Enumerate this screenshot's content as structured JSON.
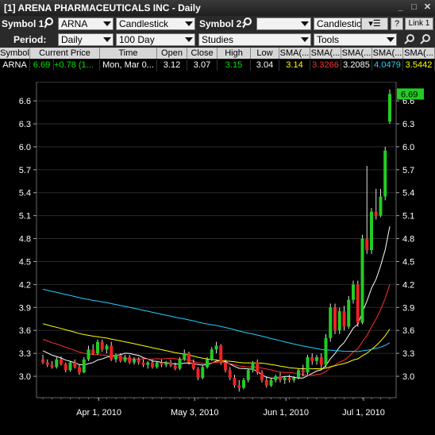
{
  "window": {
    "title": "[1] ARENA PHARMACEUTICALS INC - Daily"
  },
  "toolbar1": {
    "symbol1_label": "Symbol 1:",
    "symbol1_value": "ARNA",
    "chart_type": "Candlestick",
    "symbol2_label": "Symbol 2:",
    "symbol2_value": "",
    "chart_type2": "Candlestick",
    "help_label": "?",
    "link_label": "Link 1"
  },
  "toolbar2": {
    "period_label": "Period:",
    "period_value": "Daily",
    "range_value": "100 Day",
    "studies_value": "Studies",
    "tools_value": "Tools"
  },
  "quote": {
    "headers": [
      "Symbol",
      "Current Price",
      "Time",
      "Open",
      "Close",
      "High",
      "Low",
      "SMA(...",
      "SMA(...",
      "SMA(...",
      "SMA(...",
      "SMA(..."
    ],
    "values": [
      "ARNA",
      "6.69",
      "+0.78 (1...",
      "Mon, Mar 0...",
      "3.12",
      "3.07",
      "3.15",
      "3.04",
      "3.14",
      "3.3266",
      "3.2085",
      "4.0479",
      "3.5442"
    ],
    "colors": {
      "price": "#00e000",
      "high": "#00e000",
      "sma1": "#ffff00",
      "sma2": "#ff3030",
      "sma3": "#ffffff",
      "sma4": "#20d0ff",
      "sma5": "#ffff00"
    }
  },
  "chart_data": {
    "type": "candlestick",
    "y_ticks": [
      "6.6",
      "6.3",
      "6.0",
      "5.7",
      "5.4",
      "5.1",
      "4.8",
      "4.5",
      "4.2",
      "3.9",
      "3.6",
      "3.3",
      "3.0"
    ],
    "x_ticks": [
      "Apr 1, 2010",
      "May 3, 2010",
      "Jun 1, 2010",
      "Jul 1, 2010"
    ],
    "last_price_label": "6.69",
    "ylim": [
      2.72,
      6.85
    ],
    "candles": [
      [
        3.22,
        3.28,
        3.16,
        3.18
      ],
      [
        3.18,
        3.22,
        3.12,
        3.15
      ],
      [
        3.15,
        3.2,
        3.1,
        3.12
      ],
      [
        3.12,
        3.25,
        3.1,
        3.22
      ],
      [
        3.22,
        3.26,
        3.14,
        3.16
      ],
      [
        3.16,
        3.18,
        3.05,
        3.08
      ],
      [
        3.08,
        3.2,
        3.06,
        3.18
      ],
      [
        3.18,
        3.22,
        3.1,
        3.12
      ],
      [
        3.12,
        3.15,
        3.02,
        3.05
      ],
      [
        3.05,
        3.25,
        3.04,
        3.22
      ],
      [
        3.22,
        3.4,
        3.2,
        3.35
      ],
      [
        3.35,
        3.42,
        3.28,
        3.3
      ],
      [
        3.3,
        3.48,
        3.28,
        3.45
      ],
      [
        3.45,
        3.48,
        3.32,
        3.35
      ],
      [
        3.35,
        3.42,
        3.3,
        3.4
      ],
      [
        3.4,
        3.45,
        3.2,
        3.22
      ],
      [
        3.22,
        3.3,
        3.18,
        3.28
      ],
      [
        3.28,
        3.3,
        3.18,
        3.2
      ],
      [
        3.2,
        3.28,
        3.18,
        3.25
      ],
      [
        3.25,
        3.28,
        3.16,
        3.18
      ],
      [
        3.18,
        3.25,
        3.15,
        3.22
      ],
      [
        3.22,
        3.25,
        3.15,
        3.18
      ],
      [
        3.18,
        3.22,
        3.12,
        3.15
      ],
      [
        3.15,
        3.2,
        3.1,
        3.18
      ],
      [
        3.18,
        3.22,
        3.1,
        3.12
      ],
      [
        3.12,
        3.2,
        3.1,
        3.18
      ],
      [
        3.18,
        3.22,
        3.12,
        3.15
      ],
      [
        3.15,
        3.2,
        3.12,
        3.18
      ],
      [
        3.18,
        3.22,
        3.12,
        3.14
      ],
      [
        3.14,
        3.18,
        3.08,
        3.1
      ],
      [
        3.1,
        3.25,
        3.08,
        3.22
      ],
      [
        3.22,
        3.35,
        3.2,
        3.3
      ],
      [
        3.3,
        3.32,
        3.15,
        3.18
      ],
      [
        3.18,
        3.22,
        3.08,
        3.1
      ],
      [
        3.1,
        3.12,
        2.95,
        2.98
      ],
      [
        2.98,
        3.15,
        2.96,
        3.12
      ],
      [
        3.12,
        3.25,
        3.1,
        3.22
      ],
      [
        3.22,
        3.38,
        3.2,
        3.35
      ],
      [
        3.35,
        3.45,
        3.3,
        3.4
      ],
      [
        3.4,
        3.42,
        3.15,
        3.18
      ],
      [
        3.18,
        3.22,
        3.05,
        3.08
      ],
      [
        3.08,
        3.12,
        2.95,
        2.98
      ],
      [
        2.98,
        3.02,
        2.85,
        2.88
      ],
      [
        2.88,
        2.95,
        2.8,
        2.85
      ],
      [
        2.85,
        2.98,
        2.83,
        2.95
      ],
      [
        2.95,
        3.1,
        2.92,
        3.08
      ],
      [
        3.08,
        3.2,
        3.05,
        3.18
      ],
      [
        3.18,
        3.22,
        3.02,
        3.05
      ],
      [
        3.05,
        3.08,
        2.92,
        2.95
      ],
      [
        2.95,
        3.0,
        2.85,
        2.88
      ],
      [
        2.88,
        2.98,
        2.86,
        2.95
      ],
      [
        2.95,
        3.02,
        2.92,
        3.0
      ],
      [
        3.0,
        3.05,
        2.92,
        2.95
      ],
      [
        2.95,
        3.0,
        2.9,
        2.98
      ],
      [
        2.98,
        3.02,
        2.92,
        2.95
      ],
      [
        2.95,
        3.0,
        2.92,
        2.98
      ],
      [
        2.98,
        3.1,
        2.96,
        3.08
      ],
      [
        3.08,
        3.15,
        3.0,
        3.05
      ],
      [
        3.05,
        3.28,
        3.02,
        3.25
      ],
      [
        3.25,
        3.3,
        3.15,
        3.2
      ],
      [
        3.2,
        3.28,
        3.15,
        3.25
      ],
      [
        3.25,
        3.3,
        3.1,
        3.15
      ],
      [
        3.15,
        3.55,
        3.12,
        3.5
      ],
      [
        3.5,
        3.95,
        3.45,
        3.9
      ],
      [
        3.9,
        3.95,
        3.55,
        3.6
      ],
      [
        3.6,
        3.9,
        3.55,
        3.85
      ],
      [
        3.85,
        3.92,
        3.6,
        3.65
      ],
      [
        3.65,
        4.05,
        3.62,
        4.0
      ],
      [
        4.0,
        4.25,
        3.95,
        4.2
      ],
      [
        4.2,
        4.25,
        3.65,
        3.7
      ],
      [
        3.7,
        4.85,
        3.68,
        4.8
      ],
      [
        4.8,
        5.75,
        4.6,
        4.65
      ],
      [
        4.65,
        5.2,
        4.6,
        5.15
      ],
      [
        5.15,
        5.45,
        5.05,
        5.1
      ],
      [
        5.1,
        5.45,
        5.08,
        5.35
      ],
      [
        5.35,
        6.0,
        5.3,
        5.95
      ],
      [
        6.33,
        6.75,
        6.3,
        6.69
      ]
    ]
  }
}
